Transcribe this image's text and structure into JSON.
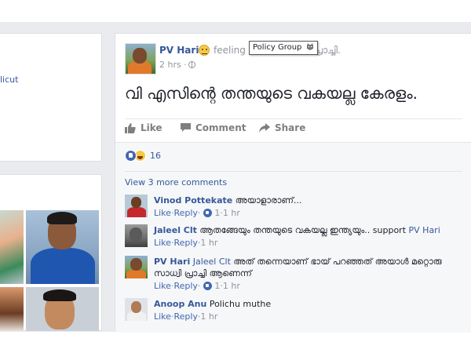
{
  "left": {
    "fragment_text": "licut"
  },
  "post": {
    "author": "PV Hari",
    "feeling_text": "feeling c",
    "feeling_tail": "പ്രാച്ചി.",
    "tooltip": "Policy Group",
    "timestamp": "2 hrs · ",
    "text": "വി എസിന്റെ തന്തയുടെ വകയല്ല കേരളം.",
    "actions": {
      "like": "Like",
      "comment": "Comment",
      "share": "Share"
    },
    "reaction_count": "16",
    "view_more": "View 3 more comments"
  },
  "comments": [
    {
      "name": "Vinod Pottekate",
      "tag": "",
      "text": " അയാളാരാണ്...",
      "meta": {
        "like": "Like",
        "reply": "Reply",
        "likes": "1",
        "time": "1 hr"
      }
    },
    {
      "name": "Jaleel Clt",
      "tag": "PV Hari",
      "text": " ആതങ്ങേയും തന്തയുടെ വകയല്ല ഇന്ത്യയും.. support ",
      "meta": {
        "like": "Like",
        "reply": "Reply",
        "likes": "",
        "time": "1 hr"
      }
    },
    {
      "name": "PV Hari",
      "tag": "Jaleel Clt",
      "text": " അത് തന്നെയാണ് ഭായ് പറഞ്ഞത് അയാൾ മറ്റൊരു സാധ്വി പ്രാച്ചി ആണെന്ന്",
      "meta": {
        "like": "Like",
        "reply": "Reply",
        "likes": "1",
        "time": "1 hr"
      }
    },
    {
      "name": "Anoop Anu",
      "tag": "",
      "text": " Polichu muthe",
      "meta": {
        "like": "Like",
        "reply": "Reply",
        "likes": "",
        "time": "1 hr"
      }
    }
  ],
  "meta_sep": " · ",
  "icons": {
    "feeling": "smiley-icon",
    "privacy": "globe-icon",
    "like": "thumbs-up-icon",
    "comment": "speech-bubble-icon",
    "share": "share-arrow-icon",
    "reactions": [
      "like-reaction-icon",
      "haha-reaction-icon"
    ]
  },
  "colors": {
    "link": "#365899",
    "feed_bg": "#e9ebee",
    "like_blue": "#4267b2"
  }
}
